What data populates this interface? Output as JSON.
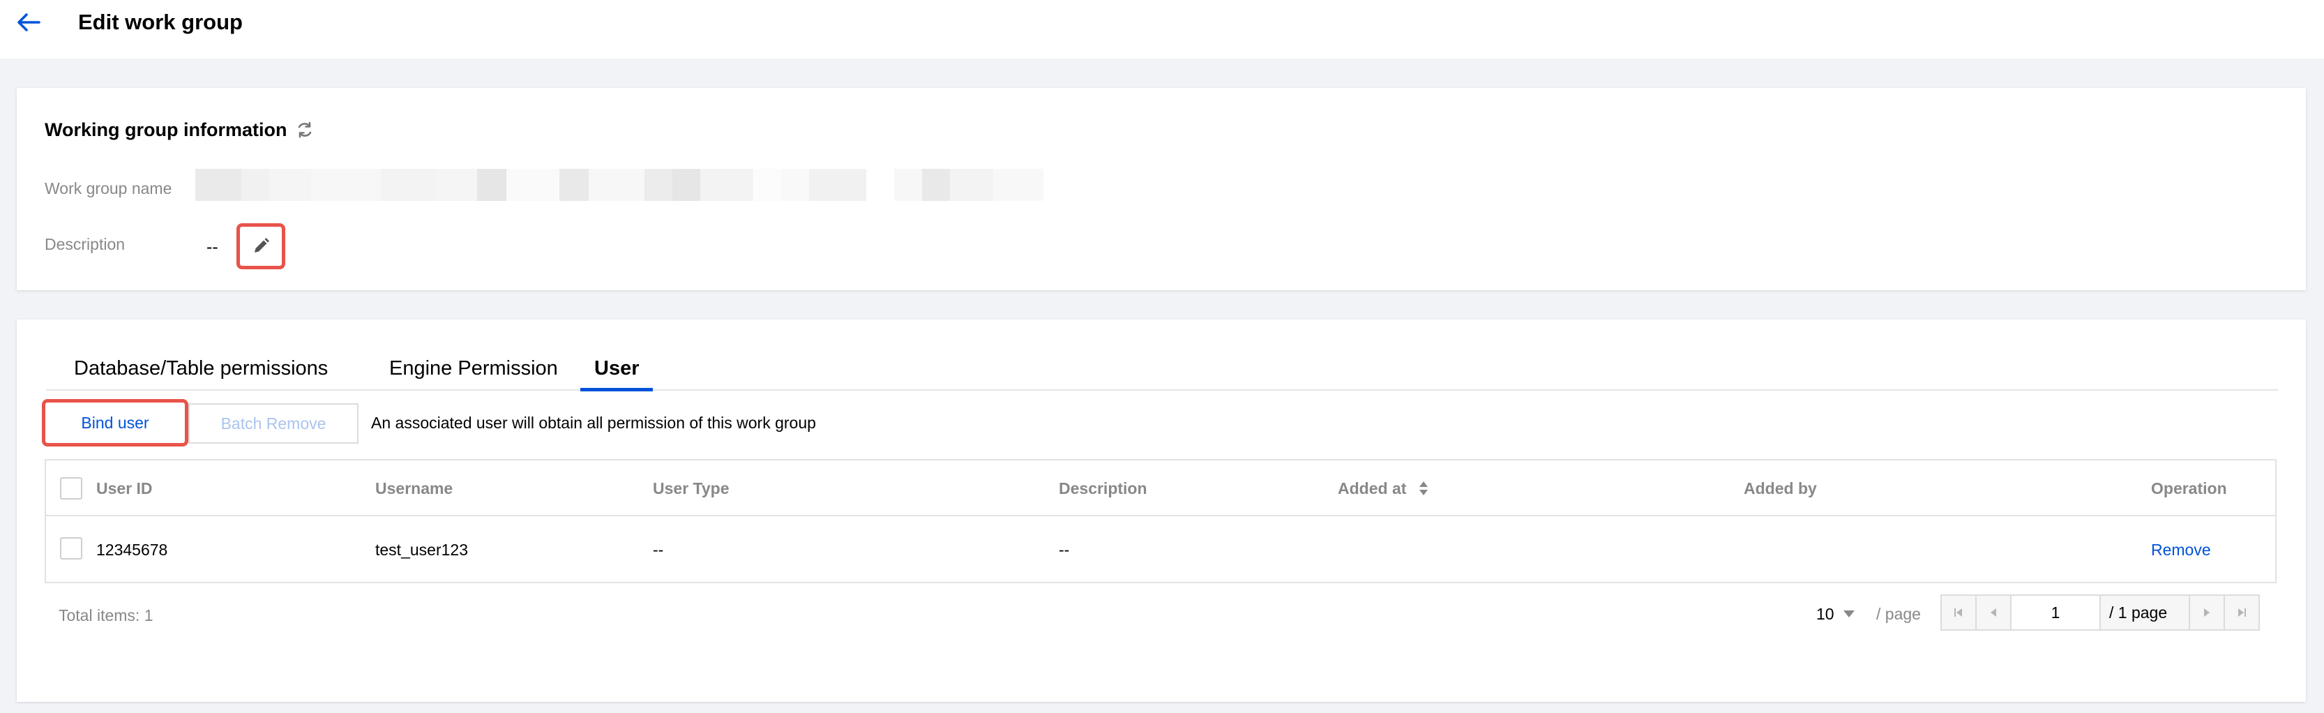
{
  "header": {
    "title": "Edit work group",
    "back_icon": "arrow-left-icon"
  },
  "info": {
    "title": "Working group information",
    "refresh_icon": "refresh-icon",
    "name_label": "Work group name",
    "description_label": "Description",
    "description_value": "--",
    "edit_icon": "pencil-icon"
  },
  "tabs": [
    {
      "label": "Database/Table permissions",
      "active": false
    },
    {
      "label": "Engine Permission",
      "active": false
    },
    {
      "label": "User",
      "active": true
    }
  ],
  "toolbar": {
    "bind_label": "Bind user",
    "batch_remove_label": "Batch Remove",
    "hint": "An associated user will obtain all permission of this work group"
  },
  "table": {
    "columns": [
      "User ID",
      "Username",
      "User Type",
      "Description",
      "Added at",
      "Added by",
      "Operation"
    ],
    "rows": [
      {
        "user_id": "12345678",
        "username": "test_user123",
        "user_type": "--",
        "description": "--",
        "added_at": "",
        "added_by": "",
        "operation": "Remove"
      }
    ]
  },
  "pagination": {
    "total_label": "Total items:",
    "total": "1",
    "page_size": "10",
    "per_page_label": "/ page",
    "current_page": "1",
    "page_total": "/ 1 page"
  },
  "colors": {
    "accent": "#0052d9",
    "highlight_border": "#e8534a",
    "page_bg": "#f2f3f6"
  }
}
